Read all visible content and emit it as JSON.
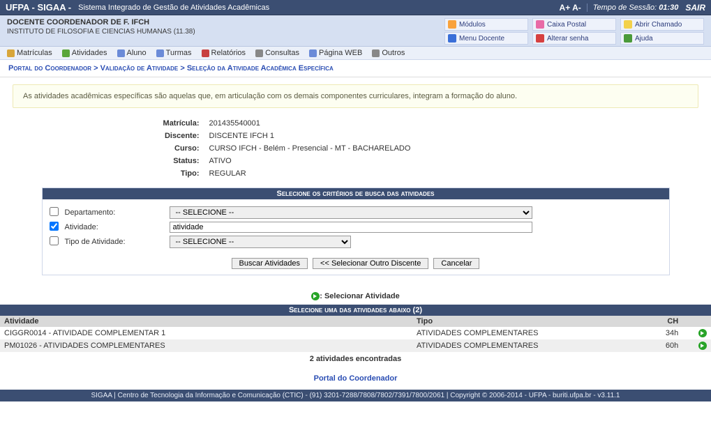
{
  "topbar": {
    "app_short": "UFPA - SIGAA -",
    "app_long": "Sistema Integrado de Gestão de Atividades Acadêmicas",
    "access_plus": "A+",
    "access_minus": "A-",
    "session_label": "Tempo de Sessão:",
    "session_time": "01:30",
    "logout": "SAIR"
  },
  "userbar": {
    "role": "DOCENTE COORDENADOR DE F. IFCH",
    "dept": "INSTITUTO DE FILOSOFIA E CIENCIAS HUMANAS (11.38)",
    "quicklinks": {
      "modulos": "Módulos",
      "caixa_postal": "Caixa Postal",
      "abrir_chamado": "Abrir Chamado",
      "menu_docente": "Menu Docente",
      "alterar_senha": "Alterar senha",
      "ajuda": "Ajuda"
    }
  },
  "menubar": {
    "matriculas": "Matrículas",
    "atividades": "Atividades",
    "aluno": "Aluno",
    "turmas": "Turmas",
    "relatorios": "Relatórios",
    "consultas": "Consultas",
    "pagina_web": "Página WEB",
    "outros": "Outros"
  },
  "breadcrumb": {
    "a": "Portal do Coordenador",
    "b": "Validação de Atividade",
    "c": "Seleção da Atividade Acadêmica Específica",
    "sep": ">"
  },
  "infobox": "As atividades acadêmicas específicas são aquelas que, em articulação com os demais componentes curriculares, integram a formação do aluno.",
  "details": {
    "matricula_label": "Matrícula:",
    "matricula_value": "201435540001",
    "discente_label": "Discente:",
    "discente_value": "DISCENTE IFCH 1",
    "curso_label": "Curso:",
    "curso_value": "CURSO IFCH - Belém - Presencial - MT - BACHARELADO",
    "status_label": "Status:",
    "status_value": "ATIVO",
    "tipo_label": "Tipo:",
    "tipo_value": "REGULAR"
  },
  "filter": {
    "panel_title": "Selecione os critérios de busca das atividades",
    "departamento_label": "Departamento:",
    "departamento_selected": "-- SELECIONE --",
    "atividade_label": "Atividade:",
    "atividade_value": "atividade",
    "tipoatividade_label": "Tipo de Atividade:",
    "tipoatividade_selected": "-- SELECIONE --",
    "btn_buscar": "Buscar Atividades",
    "btn_outro": "<< Selecionar Outro Discente",
    "btn_cancel": "Cancelar"
  },
  "legend": {
    "text": ": Selecionar Atividade"
  },
  "results": {
    "count": 2,
    "panel_title": "Selecione uma das atividades abaixo (2)",
    "col_atividade": "Atividade",
    "col_tipo": "Tipo",
    "col_ch": "CH",
    "rows": [
      {
        "atividade": "CIGGR0014 - ATIVIDADE COMPLEMENTAR 1",
        "tipo": "ATIVIDADES COMPLEMENTARES",
        "ch": "34h"
      },
      {
        "atividade": "PM01026 - ATIVIDADES COMPLEMENTARES",
        "tipo": "ATIVIDADES COMPLEMENTARES",
        "ch": "60h"
      }
    ],
    "found": "2 atividades encontradas"
  },
  "backlink": "Portal do Coordenador",
  "footer": "SIGAA | Centro de Tecnologia da Informação e Comunicação (CTIC) - (91) 3201-7288/7808/7802/7391/7800/2061 | Copyright © 2006-2014 - UFPA - buriti.ufpa.br - v3.11.1"
}
